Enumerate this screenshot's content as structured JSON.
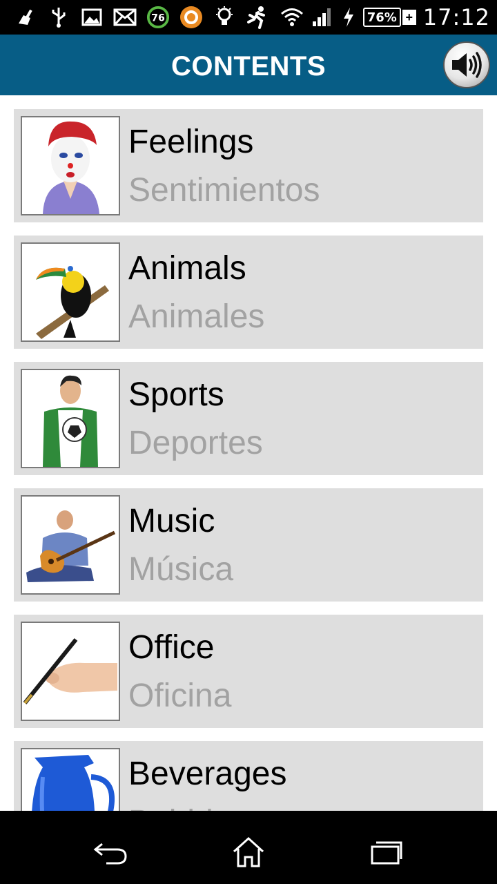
{
  "status_bar": {
    "time": "17:12",
    "battery_percent": "76%",
    "badge_number": "76",
    "icons": [
      "broom-icon",
      "usb-icon",
      "image-icon",
      "mail-icon",
      "circle-badge-icon",
      "orange-app-icon",
      "lightbulb-icon",
      "runner-icon",
      "wifi-icon",
      "signal-icon",
      "charging-icon"
    ]
  },
  "header": {
    "title": "CONTENTS",
    "sound_icon": "speaker-icon"
  },
  "categories": [
    {
      "en": "Feelings",
      "es": "Sentimientos",
      "image": "clown-icon"
    },
    {
      "en": "Animals",
      "es": "Animales",
      "image": "toucan-icon"
    },
    {
      "en": "Sports",
      "es": "Deportes",
      "image": "soccer-player-icon"
    },
    {
      "en": "Music",
      "es": "Música",
      "image": "guitar-player-icon"
    },
    {
      "en": "Office",
      "es": "Oficina",
      "image": "pen-hand-icon"
    },
    {
      "en": "Beverages",
      "es": "Bebidas",
      "image": "pitcher-icon"
    }
  ],
  "nav": {
    "icons": [
      "back-icon",
      "home-icon",
      "recents-icon"
    ]
  },
  "colors": {
    "header_bg": "#075d86",
    "item_bg": "#dedede",
    "secondary_text": "#a2a2a2"
  }
}
